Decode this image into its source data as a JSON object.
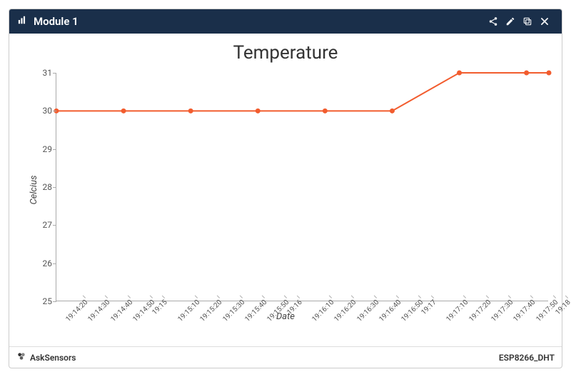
{
  "header": {
    "title": "Module 1"
  },
  "footer": {
    "brand": "AskSensors",
    "device": "ESP8266_DHT"
  },
  "chart_data": {
    "type": "line",
    "title": "Temperature",
    "xlabel": "Date",
    "ylabel": "Celcius",
    "ylim": [
      25,
      31
    ],
    "yticks": [
      25,
      26,
      27,
      28,
      29,
      30,
      31
    ],
    "xticks": [
      "19:14:20",
      "19:14:30",
      "19:14:40",
      "19:14:50",
      "19:15",
      "19:15:10",
      "19:15:20",
      "19:15:30",
      "19:15:40",
      "19:15:50",
      "19:16",
      "19:16:10",
      "19:16:20",
      "19:16:30",
      "19:16:40",
      "19:16:50",
      "19:17",
      "19:17:10",
      "19:17:20",
      "19:17:30",
      "19:17:40",
      "19:17:50",
      "19:18"
    ],
    "series": [
      {
        "name": "Temperature",
        "color": "#f25c2e",
        "points": [
          {
            "x": "19:14:20",
            "y": 30
          },
          {
            "x": "19:14:50",
            "y": 30
          },
          {
            "x": "19:15:20",
            "y": 30
          },
          {
            "x": "19:15:50",
            "y": 30
          },
          {
            "x": "19:16:20",
            "y": 30
          },
          {
            "x": "19:16:50",
            "y": 30
          },
          {
            "x": "19:17:20",
            "y": 31
          },
          {
            "x": "19:17:50",
            "y": 31
          },
          {
            "x": "19:18",
            "y": 31
          }
        ]
      }
    ]
  }
}
